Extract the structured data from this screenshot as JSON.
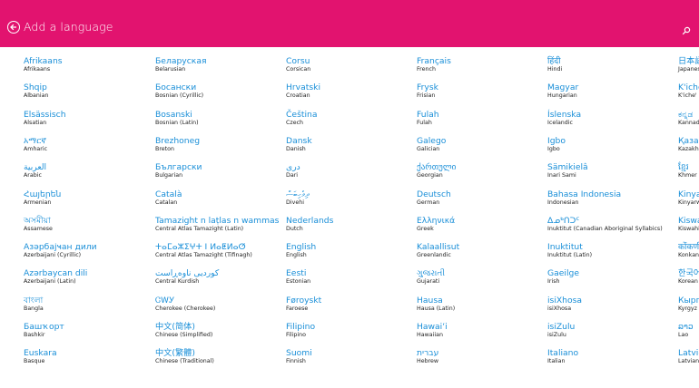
{
  "header": {
    "title": "Add a language",
    "background": "#e2136f",
    "back_icon": "back-arrow-circle-icon",
    "search_icon": "search-icon"
  },
  "colors": {
    "native_link": "#1a8fd8",
    "english_text": "#222222"
  },
  "columns": [
    [
      {
        "native": "Afrikaans",
        "english": "Afrikaans"
      },
      {
        "native": "Shqip",
        "english": "Albanian"
      },
      {
        "native": "Elsässisch",
        "english": "Alsatian"
      },
      {
        "native": "አማርኛ",
        "english": "Amharic"
      },
      {
        "native": "العربية",
        "english": "Arabic"
      },
      {
        "native": "Հայերեն",
        "english": "Armenian"
      },
      {
        "native": "অসমীয়া",
        "english": "Assamese"
      },
      {
        "native": "Азәрбајҹан дили",
        "english": "Azerbaijani (Cyrillic)"
      },
      {
        "native": "Azərbaycan dili",
        "english": "Azerbaijani (Latin)"
      },
      {
        "native": "বাংলা",
        "english": "Bangla"
      },
      {
        "native": "Башҡорт",
        "english": "Bashkir"
      },
      {
        "native": "Euskara",
        "english": "Basque"
      }
    ],
    [
      {
        "native": "Беларуская",
        "english": "Belarusian"
      },
      {
        "native": "Босански",
        "english": "Bosnian (Cyrillic)"
      },
      {
        "native": "Bosanski",
        "english": "Bosnian (Latin)"
      },
      {
        "native": "Brezhoneg",
        "english": "Breton"
      },
      {
        "native": "Български",
        "english": "Bulgarian"
      },
      {
        "native": "Català",
        "english": "Catalan"
      },
      {
        "native": "Tamazight n laṭlas n wammas",
        "english": "Central Atlas Tamazight (Latin)"
      },
      {
        "native": "ⵜⴰⵎⴰⵣⵉⵖⵜ ⵏ ⵍⴰⵟⵍⴰⵚ",
        "english": "Central Atlas Tamazight (Tifinagh)"
      },
      {
        "native": "کوردیی ناوەڕاست",
        "english": "Central Kurdish"
      },
      {
        "native": "ᏣᎳᎩ",
        "english": "Cherokee (Cherokee)"
      },
      {
        "native": "中文(简体)",
        "english": "Chinese (Simplified)"
      },
      {
        "native": "中文(繁體)",
        "english": "Chinese (Traditional)"
      }
    ],
    [
      {
        "native": "Corsu",
        "english": "Corsican"
      },
      {
        "native": "Hrvatski",
        "english": "Croatian"
      },
      {
        "native": "Čeština",
        "english": "Czech"
      },
      {
        "native": "Dansk",
        "english": "Danish"
      },
      {
        "native": "درى",
        "english": "Dari"
      },
      {
        "native": "ދިވެހިބަސް",
        "english": "Divehi"
      },
      {
        "native": "Nederlands",
        "english": "Dutch"
      },
      {
        "native": "English",
        "english": "English"
      },
      {
        "native": "Eesti",
        "english": "Estonian"
      },
      {
        "native": "Føroyskt",
        "english": "Faroese"
      },
      {
        "native": "Filipino",
        "english": "Filipino"
      },
      {
        "native": "Suomi",
        "english": "Finnish"
      }
    ],
    [
      {
        "native": "Français",
        "english": "French"
      },
      {
        "native": "Frysk",
        "english": "Frisian"
      },
      {
        "native": "Fulah",
        "english": "Fulah"
      },
      {
        "native": "Galego",
        "english": "Galician"
      },
      {
        "native": "ქართული",
        "english": "Georgian"
      },
      {
        "native": "Deutsch",
        "english": "German"
      },
      {
        "native": "Ελληνικά",
        "english": "Greek"
      },
      {
        "native": "Kalaallisut",
        "english": "Greenlandic"
      },
      {
        "native": "ગુજરાતી",
        "english": "Gujarati"
      },
      {
        "native": "Hausa",
        "english": "Hausa (Latin)"
      },
      {
        "native": "Hawaiʻi",
        "english": "Hawaiian"
      },
      {
        "native": "עברית",
        "english": "Hebrew"
      }
    ],
    [
      {
        "native": "हिंदी",
        "english": "Hindi"
      },
      {
        "native": "Magyar",
        "english": "Hungarian"
      },
      {
        "native": "Íslenska",
        "english": "Icelandic"
      },
      {
        "native": "Igbo",
        "english": "Igbo"
      },
      {
        "native": "Sämikielâ",
        "english": "Inari Sami"
      },
      {
        "native": "Bahasa Indonesia",
        "english": "Indonesian"
      },
      {
        "native": "ᐃᓄᒃᑎᑐᑦ",
        "english": "Inuktitut (Canadian Aboriginal Syllabics)"
      },
      {
        "native": "Inuktitut",
        "english": "Inuktitut (Latin)"
      },
      {
        "native": "Gaeilge",
        "english": "Irish"
      },
      {
        "native": "isiXhosa",
        "english": "isiXhosa"
      },
      {
        "native": "isiZulu",
        "english": "isiZulu"
      },
      {
        "native": "Italiano",
        "english": "Italian"
      }
    ],
    [
      {
        "native": "日本語",
        "english": "Japanese"
      },
      {
        "native": "K'iche'",
        "english": "K'iche'"
      },
      {
        "native": "ಕನ್ನಡ",
        "english": "Kannada"
      },
      {
        "native": "Қазақ",
        "english": "Kazakh"
      },
      {
        "native": "ខ្មែរ",
        "english": "Khmer"
      },
      {
        "native": "Kinyarwanda",
        "english": "Kinyarwanda"
      },
      {
        "native": "Kiswahili",
        "english": "Kiswahili"
      },
      {
        "native": "कोंकणी",
        "english": "Konkani"
      },
      {
        "native": "한국어",
        "english": "Korean"
      },
      {
        "native": "Кыргыз",
        "english": "Kyrgyz"
      },
      {
        "native": "ລາວ",
        "english": "Lao"
      },
      {
        "native": "Latviešu",
        "english": "Latvian"
      }
    ]
  ]
}
